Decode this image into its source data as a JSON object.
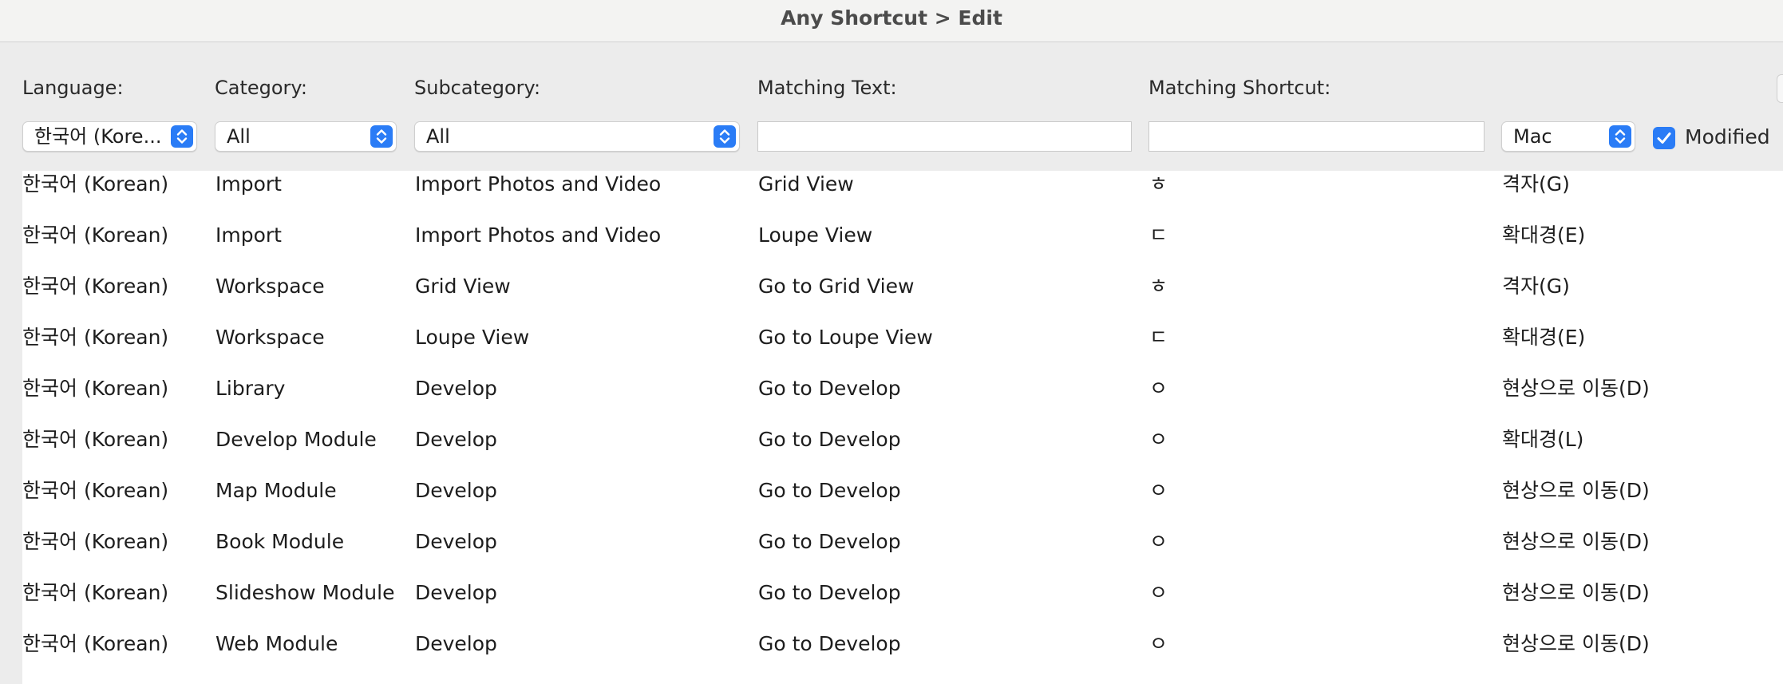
{
  "window": {
    "title": "Any Shortcut > Edit"
  },
  "filters": {
    "language": {
      "label": "Language:",
      "value": "한국어 (Kore..."
    },
    "category": {
      "label": "Category:",
      "value": "All"
    },
    "subcategory": {
      "label": "Subcategory:",
      "value": "All"
    },
    "matching_text": {
      "label": "Matching Text:",
      "value": ""
    },
    "matching_shortcut": {
      "label": "Matching Shortcut:",
      "value": ""
    },
    "platform": {
      "value": "Mac"
    },
    "modified": {
      "label": "Modified",
      "checked": true
    }
  },
  "colors": {
    "accent": "#2a7cf6",
    "window_bg": "#ececec",
    "table_bg": "#ffffff"
  },
  "rows": [
    {
      "language": "한국어 (Korean)",
      "category": "Import",
      "subcategory": "Import Photos and Video",
      "matching_text": "Grid View",
      "matching_shortcut": "ㅎ",
      "result": "격자(G)"
    },
    {
      "language": "한국어 (Korean)",
      "category": "Import",
      "subcategory": "Import Photos and Video",
      "matching_text": "Loupe View",
      "matching_shortcut": "ㄷ",
      "result": "확대경(E)"
    },
    {
      "language": "한국어 (Korean)",
      "category": "Workspace",
      "subcategory": "Grid View",
      "matching_text": "Go to Grid View",
      "matching_shortcut": "ㅎ",
      "result": "격자(G)"
    },
    {
      "language": "한국어 (Korean)",
      "category": "Workspace",
      "subcategory": "Loupe View",
      "matching_text": "Go to Loupe View",
      "matching_shortcut": "ㄷ",
      "result": "확대경(E)"
    },
    {
      "language": "한국어 (Korean)",
      "category": "Library",
      "subcategory": "Develop",
      "matching_text": "Go to Develop",
      "matching_shortcut": "ㅇ",
      "result": "현상으로 이동(D)"
    },
    {
      "language": "한국어 (Korean)",
      "category": "Develop Module",
      "subcategory": "Develop",
      "matching_text": "Go to Develop",
      "matching_shortcut": "ㅇ",
      "result": "확대경(L)"
    },
    {
      "language": "한국어 (Korean)",
      "category": "Map Module",
      "subcategory": "Develop",
      "matching_text": "Go to Develop",
      "matching_shortcut": "ㅇ",
      "result": "현상으로 이동(D)"
    },
    {
      "language": "한국어 (Korean)",
      "category": "Book Module",
      "subcategory": "Develop",
      "matching_text": "Go to Develop",
      "matching_shortcut": "ㅇ",
      "result": "현상으로 이동(D)"
    },
    {
      "language": "한국어 (Korean)",
      "category": "Slideshow Module",
      "subcategory": "Develop",
      "matching_text": "Go to Develop",
      "matching_shortcut": "ㅇ",
      "result": "현상으로 이동(D)"
    },
    {
      "language": "한국어 (Korean)",
      "category": "Web Module",
      "subcategory": "Develop",
      "matching_text": "Go to Develop",
      "matching_shortcut": "ㅇ",
      "result": "현상으로 이동(D)"
    }
  ]
}
